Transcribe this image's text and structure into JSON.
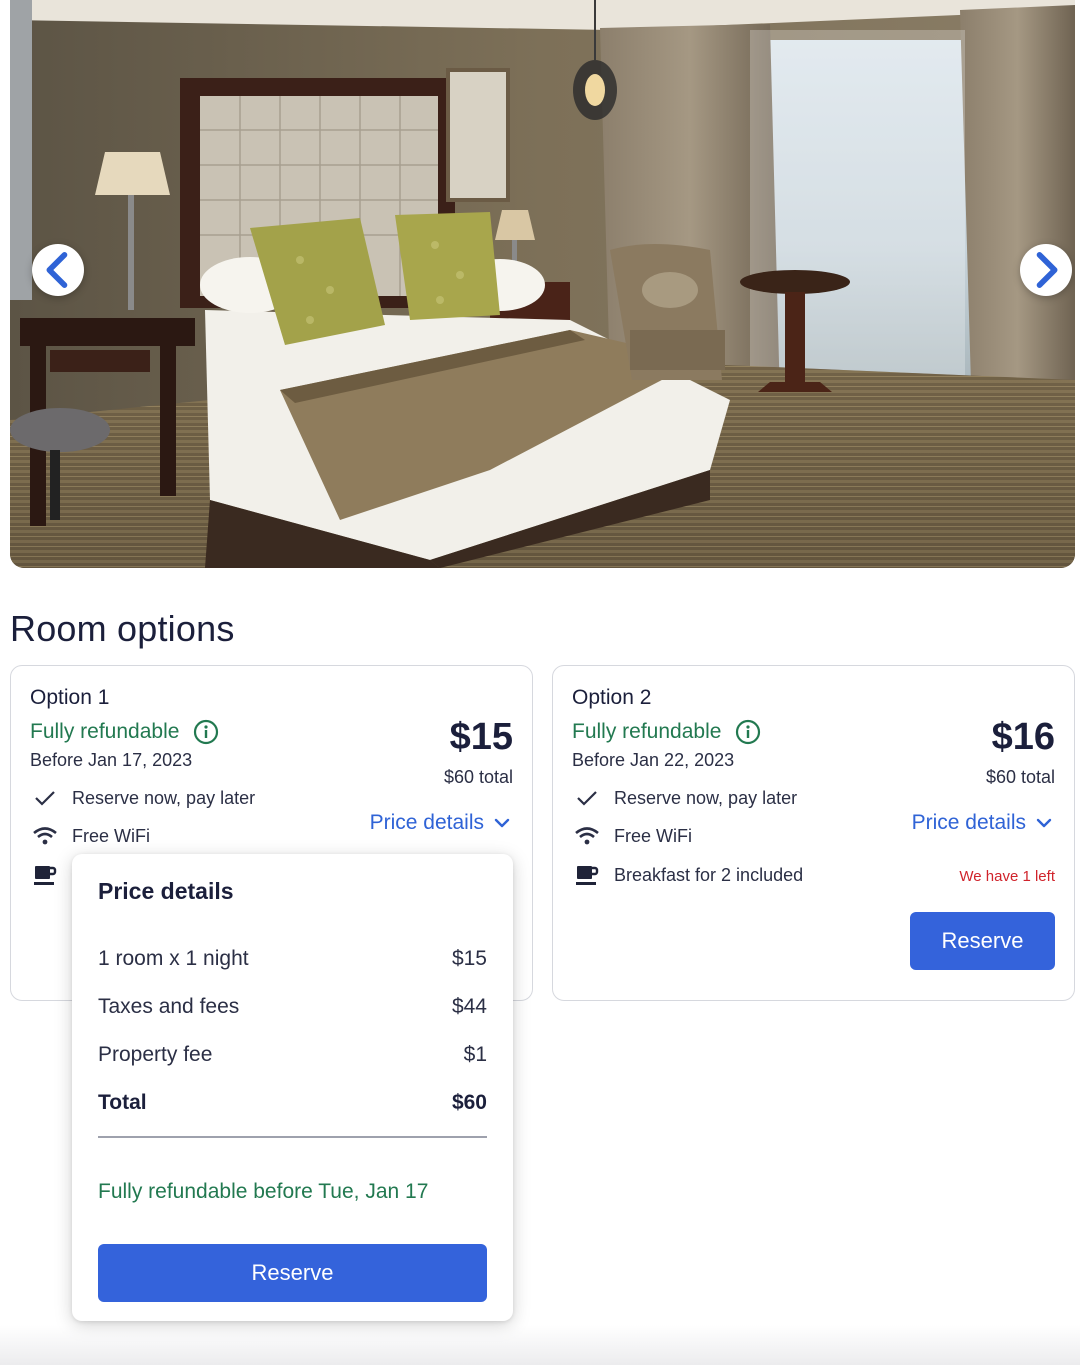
{
  "gallery": {
    "prev_icon": "chevron-left-icon",
    "next_icon": "chevron-right-icon"
  },
  "section": {
    "title": "Room options"
  },
  "options": [
    {
      "title": "Option 1",
      "refund_label": "Fully refundable",
      "refund_before": "Before Jan 17, 2023",
      "features": [
        {
          "icon": "checkmark-icon",
          "label": "Reserve now, pay later"
        },
        {
          "icon": "wifi-icon",
          "label": "Free WiFi"
        },
        {
          "icon": "coffee-cup-icon",
          "label": ""
        }
      ],
      "price": "$15",
      "total": "$60 total",
      "price_details_link": "Price details"
    },
    {
      "title": "Option 2",
      "refund_label": "Fully refundable",
      "refund_before": "Before Jan 22, 2023",
      "features": [
        {
          "icon": "checkmark-icon",
          "label": "Reserve now, pay later"
        },
        {
          "icon": "wifi-icon",
          "label": "Free WiFi"
        },
        {
          "icon": "coffee-cup-icon",
          "label": "Breakfast for 2 included"
        }
      ],
      "price": "$16",
      "total": "$60 total",
      "price_details_link": "Price details",
      "availability": "We have 1 left",
      "reserve_label": "Reserve"
    }
  ],
  "price_details": {
    "title": "Price details",
    "rows": [
      {
        "label": "1 room x 1 night",
        "value": "$15"
      },
      {
        "label": "Taxes and fees",
        "value": "$44"
      },
      {
        "label": "Property fee",
        "value": "$1"
      },
      {
        "label": "Total",
        "value": "$60"
      }
    ],
    "refund_note": "Fully refundable before Tue, Jan 17",
    "reserve_label": "Reserve"
  },
  "colors": {
    "accent": "#3463db",
    "link": "#2f63d6",
    "refund_green": "#227950",
    "alert_red": "#d0232b",
    "text": "#1b1f3b"
  }
}
